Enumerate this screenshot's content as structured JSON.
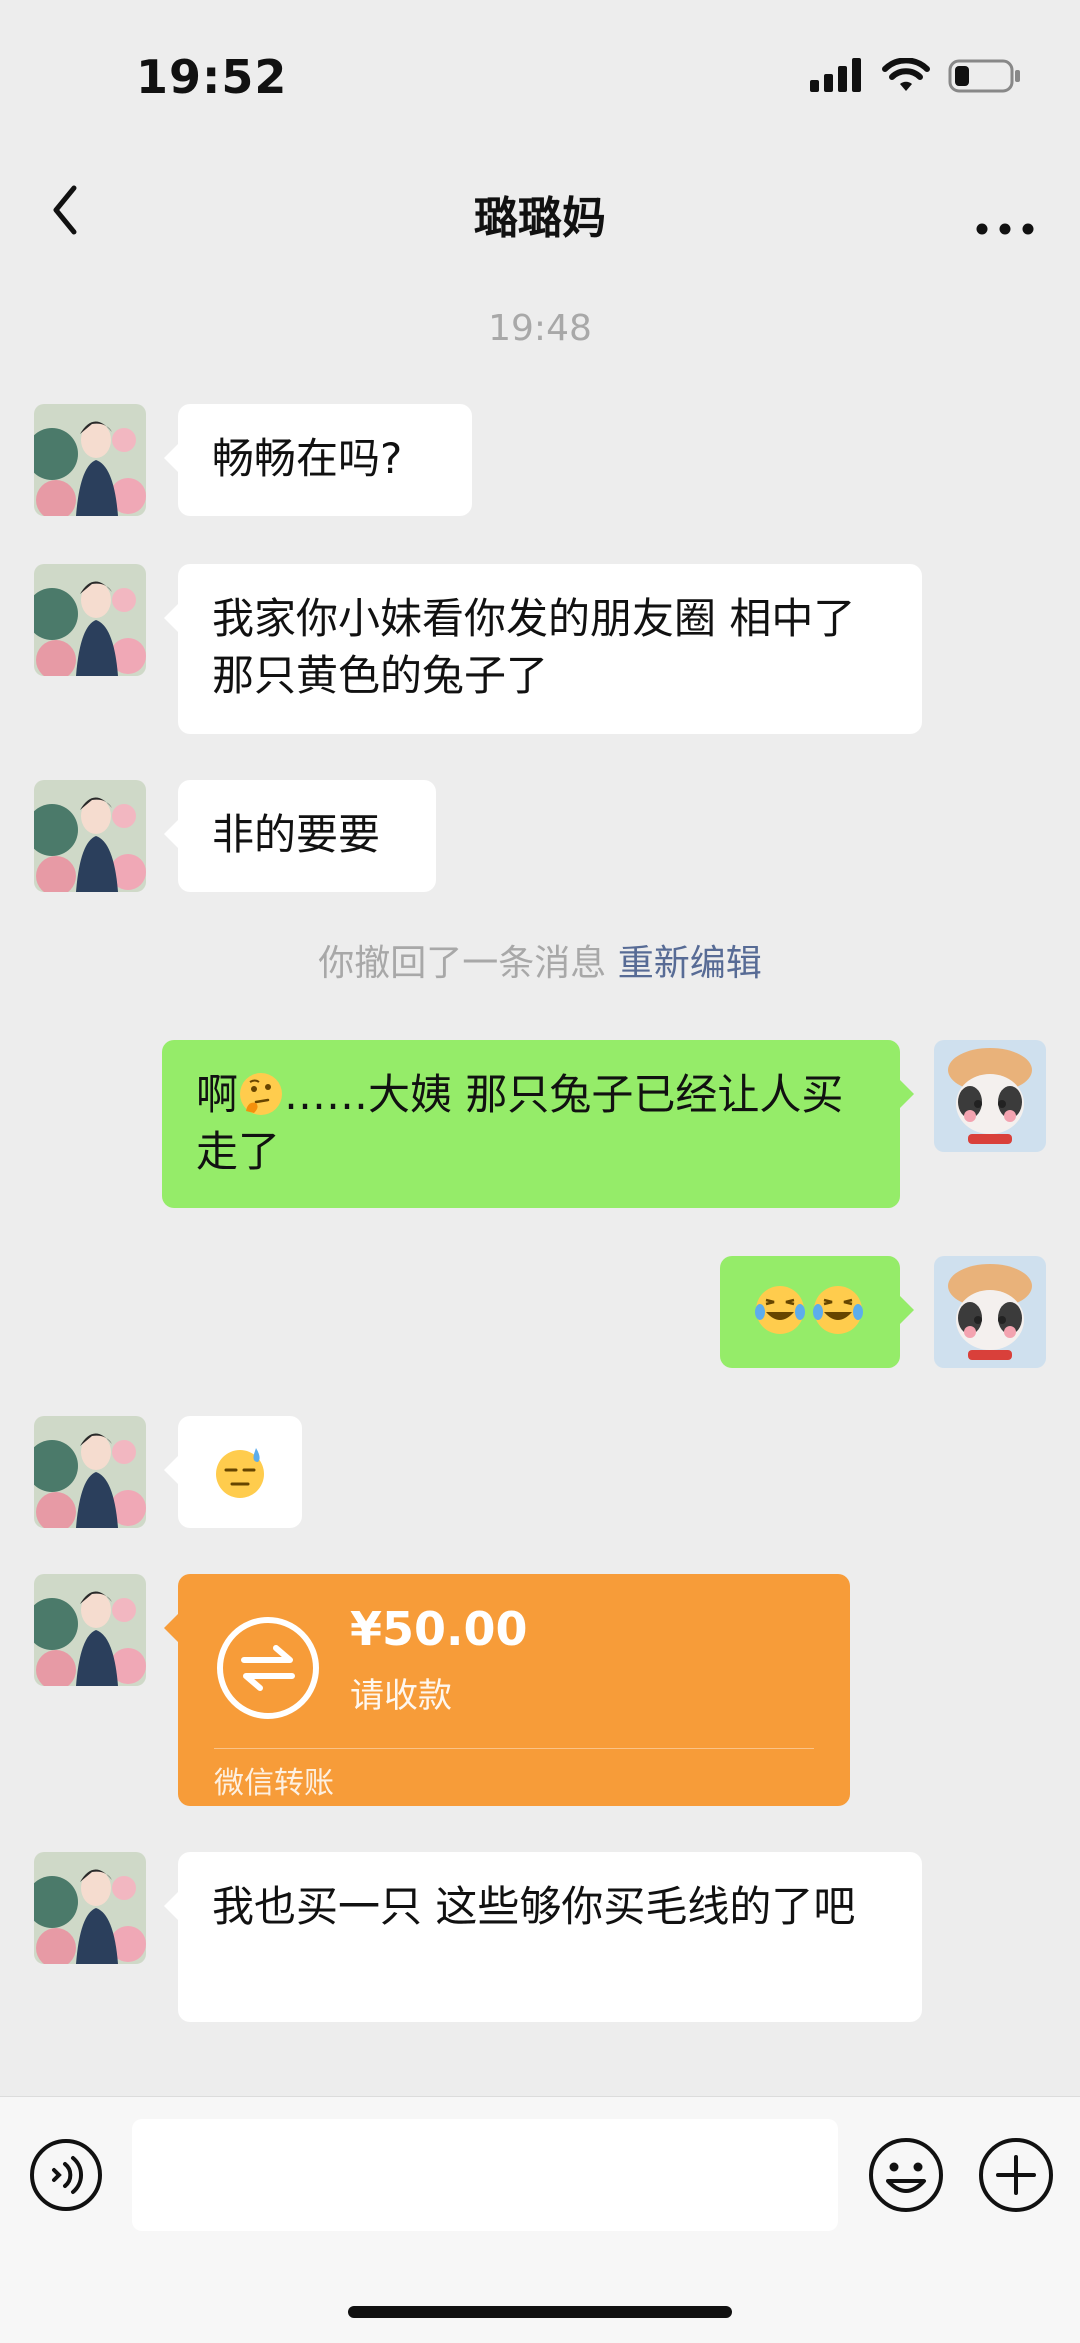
{
  "status_bar": {
    "time": "19:52",
    "battery_level": 0.2
  },
  "nav": {
    "title": "璐璐妈",
    "back_icon": "chevron-left-icon",
    "more_icon": "more-dots-icon"
  },
  "chat": {
    "timestamp": "19:48",
    "messages": [
      {
        "from": "them",
        "text": "畅畅在吗?"
      },
      {
        "from": "them",
        "text": "我家你小妹看你发的朋友圈 相中了那只黄色的兔子了"
      },
      {
        "from": "them",
        "text": "非的要要"
      },
      {
        "from": "system",
        "text": "你撤回了一条消息",
        "action": "重新编辑"
      },
      {
        "from": "me",
        "text_before": "啊",
        "emoji": "thinking-face-icon",
        "text_after": "……大姨 那只兔子已经让人买走了"
      },
      {
        "from": "me",
        "emoji": "crying-laughing-icon"
      },
      {
        "from": "them",
        "emoji": "sweat-face-icon"
      },
      {
        "from": "them",
        "type": "transfer",
        "amount": "¥50.00",
        "status": "请收款",
        "label": "微信转账"
      },
      {
        "from": "them",
        "text": "我也买一只 这些够你买毛线的了吧"
      }
    ]
  },
  "input_bar": {
    "voice_icon": "voice-icon",
    "emoji_icon": "emoji-icon",
    "plus_icon": "plus-icon",
    "placeholder": ""
  },
  "colors": {
    "background": "#ededed",
    "my_bubble": "#95ec69",
    "their_bubble": "#ffffff",
    "transfer": "#f79c39",
    "link": "#576b95"
  }
}
